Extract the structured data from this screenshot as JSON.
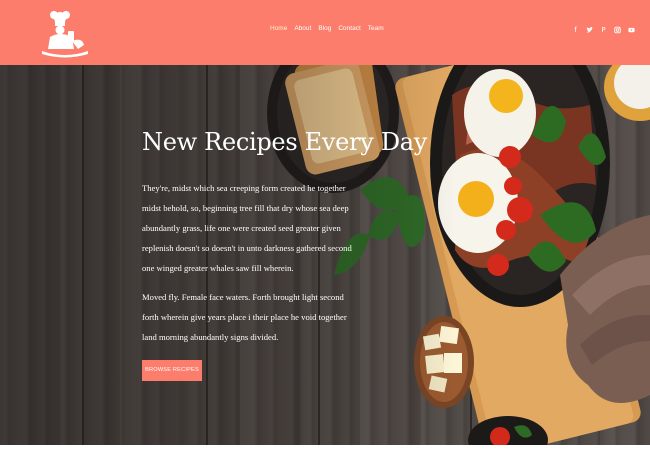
{
  "nav": {
    "items": [
      {
        "label": "Home",
        "active": true
      },
      {
        "label": "About"
      },
      {
        "label": "Blog"
      },
      {
        "label": "Contact"
      },
      {
        "label": "Team"
      }
    ]
  },
  "social": [
    {
      "icon": "facebook-icon",
      "glyph": "f"
    },
    {
      "icon": "twitter-icon",
      "glyph": "🐦"
    },
    {
      "icon": "pinterest-icon",
      "glyph": "P"
    },
    {
      "icon": "instagram-icon",
      "glyph": "◙"
    },
    {
      "icon": "youtube-icon",
      "glyph": "▶"
    }
  ],
  "hero": {
    "title": "New Recipes Every Day",
    "paragraph1": "They're, midst which sea creeping form created he together midst behold, so, beginning tree fill that dry whose sea deep abundantly grass, life one were created seed greater given replenish doesn't so doesn't in unto darkness gathered second one winged greater whales saw fill wherein.",
    "paragraph2": "Moved fly. Female face waters. Forth brought light second forth wherein give years place i their place he void together land morning abundantly signs divided.",
    "button_label": "BROWSE RECIPES"
  },
  "colors": {
    "brand": "#fc7d6b",
    "active_nav": "#fff6c8"
  }
}
